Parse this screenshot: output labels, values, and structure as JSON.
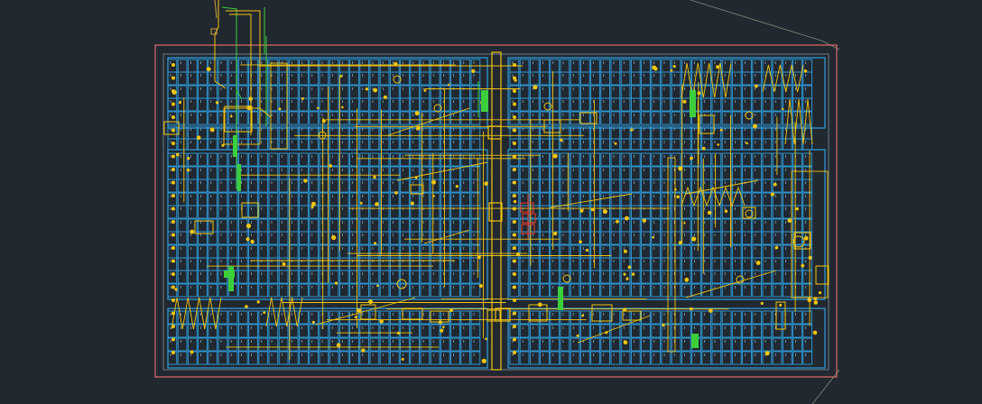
{
  "drawing": {
    "description_visible_text": "",
    "colors": {
      "background": "#212830",
      "boundary": "#e06a6a",
      "sheet_edge": "#8fa88a",
      "grid_outline": "#2f9fe0",
      "mechanical": "#f2c511",
      "service_green": "#3ccf3c",
      "detail_red": "#d23a2a",
      "inner_frame": "#6f7c86"
    },
    "layers": [
      "boundary-layer",
      "parking-grid-layer",
      "mechanical-layer",
      "service-layer",
      "detail-layer"
    ]
  }
}
